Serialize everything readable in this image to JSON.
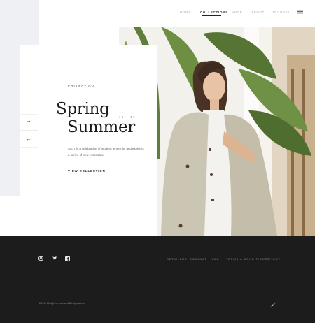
{
  "nav": {
    "items": [
      {
        "label": "Home",
        "active": false
      },
      {
        "label": "Collections",
        "active": true
      },
      {
        "label": "Shop",
        "active": false
      },
      {
        "label": "About",
        "active": false
      },
      {
        "label": "Journal",
        "active": false
      }
    ],
    "flag_icon": "flag-icon"
  },
  "hero": {
    "eyebrow": "COLLECTION",
    "title_line1": "Spring",
    "title_line2": "Summer",
    "year": "16 - 17",
    "description": "SS17 is a celebration of modern femininity and explores a series of new essentials.",
    "cta": "VIEW COLLECTION",
    "arrows": {
      "next": "→",
      "prev": "←"
    }
  },
  "footer": {
    "social": [
      {
        "name": "instagram-icon"
      },
      {
        "name": "twitter-icon"
      },
      {
        "name": "facebook-icon"
      }
    ],
    "links": [
      "RETAILERS",
      "CONTACT",
      "FAQ",
      "TERMS & CONDITIONS",
      "PRIVACY"
    ],
    "copyright": "2016. All rights reserved Designsense",
    "logo_icon": "brand-logo-icon"
  },
  "colors": {
    "accent": "#1c1c1c",
    "background": "#ffffff",
    "side_panel": "#eef0f3",
    "footer": "#1c1c1c"
  }
}
